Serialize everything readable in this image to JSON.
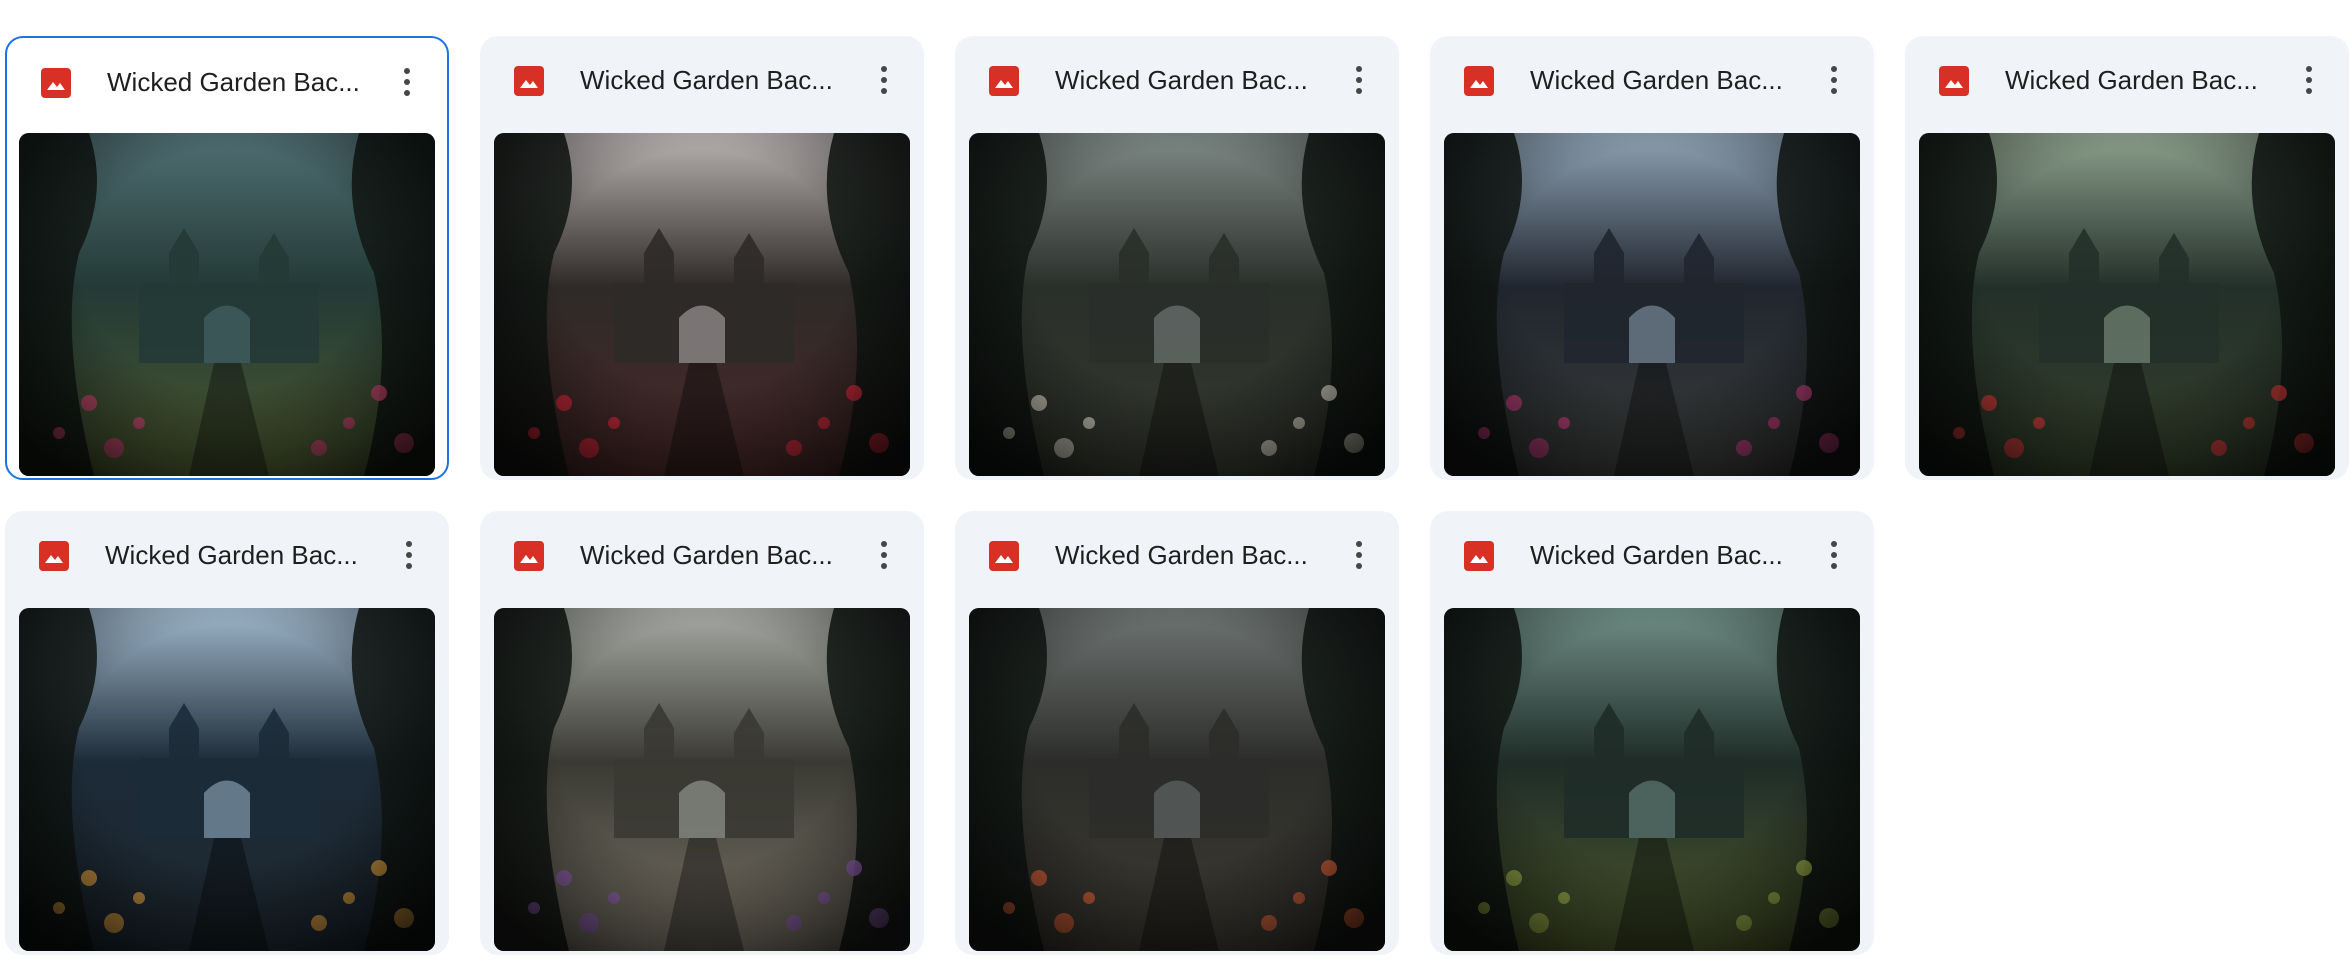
{
  "files": [
    {
      "name": "Wicked Garden Bac...",
      "selected": true,
      "thumbnail": "wicked-garden-gate-thumbnail",
      "palette": {
        "sky": "#4f6e73",
        "mid": "#233a36",
        "ground": "#4d5a30",
        "accent": "#c9446f"
      }
    },
    {
      "name": "Wicked Garden Bac...",
      "selected": false,
      "thumbnail": "wicked-garden-arch-thumbnail",
      "palette": {
        "sky": "#b9b3b2",
        "mid": "#2e2a28",
        "ground": "#4a2828",
        "accent": "#d9283b"
      }
    },
    {
      "name": "Wicked Garden Bac...",
      "selected": false,
      "thumbnail": "wicked-garden-ruins-thumbnail",
      "palette": {
        "sky": "#7f8a86",
        "mid": "#2a2f2a",
        "ground": "#34382f",
        "accent": "#d7d4c3"
      }
    },
    {
      "name": "Wicked Garden Bac...",
      "selected": false,
      "thumbnail": "wicked-garden-castle-moon-thumbnail",
      "palette": {
        "sky": "#8fa3b5",
        "mid": "#20262f",
        "ground": "#3b3d3a",
        "accent": "#c23d7c"
      }
    },
    {
      "name": "Wicked Garden Bac...",
      "selected": false,
      "thumbnail": "wicked-garden-pavilion-thumbnail",
      "palette": {
        "sky": "#8da08c",
        "mid": "#23302a",
        "ground": "#34402a",
        "accent": "#d63a3a"
      }
    },
    {
      "name": "Wicked Garden Bac...",
      "selected": false,
      "thumbnail": "wicked-garden-lake-castle-thumbnail",
      "palette": {
        "sky": "#9fb8cc",
        "mid": "#1d2b38",
        "ground": "#1d2830",
        "accent": "#e0a040"
      }
    },
    {
      "name": "Wicked Garden Bac...",
      "selected": false,
      "thumbnail": "wicked-garden-path-thumbnail",
      "palette": {
        "sky": "#a8aba6",
        "mid": "#3a3a33",
        "ground": "#7b7568",
        "accent": "#8f5fb0"
      }
    },
    {
      "name": "Wicked Garden Bac...",
      "selected": false,
      "thumbnail": "wicked-garden-stairs-thumbnail",
      "palette": {
        "sky": "#6f7573",
        "mid": "#2c2d2a",
        "ground": "#3d3a33",
        "accent": "#e0643a"
      }
    },
    {
      "name": "Wicked Garden Bac...",
      "selected": false,
      "thumbnail": "wicked-garden-mist-thumbnail",
      "palette": {
        "sky": "#6f8f86",
        "mid": "#1f2c28",
        "ground": "#4d5a2c",
        "accent": "#9db04a"
      }
    }
  ],
  "icons": {
    "file_type": "image-file-icon",
    "more": "more-vert-icon"
  },
  "colors": {
    "card_bg": "#f0f4f9",
    "selection_border": "#1a73e8",
    "file_icon_red": "#d93025"
  }
}
